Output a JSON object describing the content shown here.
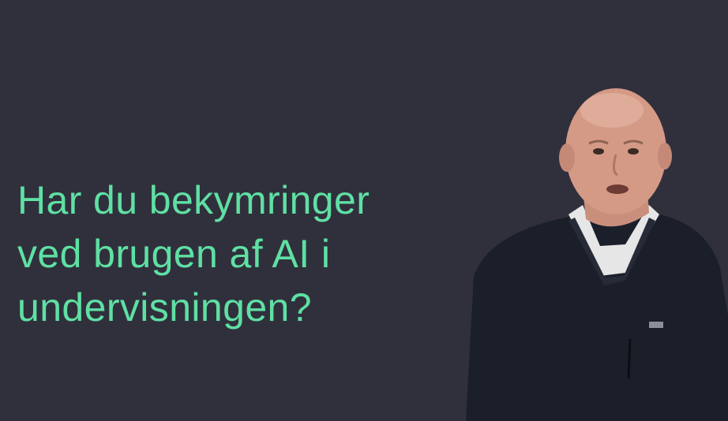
{
  "question": {
    "line1": "Har du bekymringer",
    "line2": "ved brugen af AI i",
    "line3": "undervisningen?",
    "color": "#5fe0a3"
  },
  "background_color": "#30303d",
  "speaker": {
    "icon": "person-photo"
  }
}
